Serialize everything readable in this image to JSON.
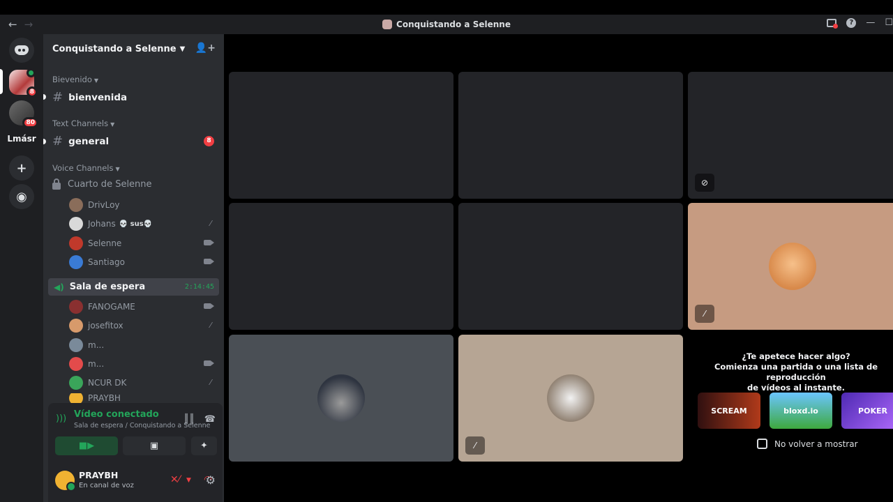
{
  "window": {
    "title": "Conquistando a Selenne",
    "back": "←",
    "forward": "→"
  },
  "guilds": {
    "selenne_badge": "8",
    "g2_badge": "80",
    "text_guild": "Lmásr"
  },
  "server": {
    "name": "Conquistando a Selenne"
  },
  "categories": {
    "welcome": "Bievenido",
    "text": "Text Channels",
    "voice": "Voice Channels"
  },
  "channels": {
    "bienvenida": "bienvenida",
    "general": "general",
    "general_badge": "8",
    "cuarto": "Cuarto de Selenne",
    "sala": "Sala de espera",
    "sala_timer": "2:14:45"
  },
  "cuarto_users": [
    {
      "name": "DrivLoy",
      "status": "",
      "color": "#8a6d5a"
    },
    {
      "name": "Johans",
      "status": "💀 sus💀",
      "color": "#d9d9d9"
    },
    {
      "name": "Selenne",
      "status": "",
      "color": "#c0392b"
    },
    {
      "name": "Santiago",
      "status": "",
      "color": "#3a7bd5"
    }
  ],
  "sala_users": [
    {
      "name": "FANOGAME",
      "color": "#8a3030"
    },
    {
      "name": "josefitox",
      "color": "#d79a6b"
    },
    {
      "name": "m...",
      "color": "#7a8a9a"
    },
    {
      "name": "m...",
      "color": "#e34b4b"
    },
    {
      "name": "NCUR DK",
      "color": "#3aa55a"
    },
    {
      "name": "PRAYBH",
      "color": "#f0b232"
    }
  ],
  "voice_panel": {
    "title": "Vídeo conectado",
    "subtitle": "Sala de espera / Conquistando a Selenne"
  },
  "user": {
    "name": "PRAYBH",
    "status": "En canal de voz"
  },
  "promo": {
    "line1": "¿Te apetece hacer algo?",
    "line2": "Comienza una partida o una lista de reproducción",
    "line3": "de vídeos al instante.",
    "games": [
      "SCREAM",
      "bloxd.io",
      "POKER"
    ],
    "checkbox_label": "No volver a mostrar"
  }
}
